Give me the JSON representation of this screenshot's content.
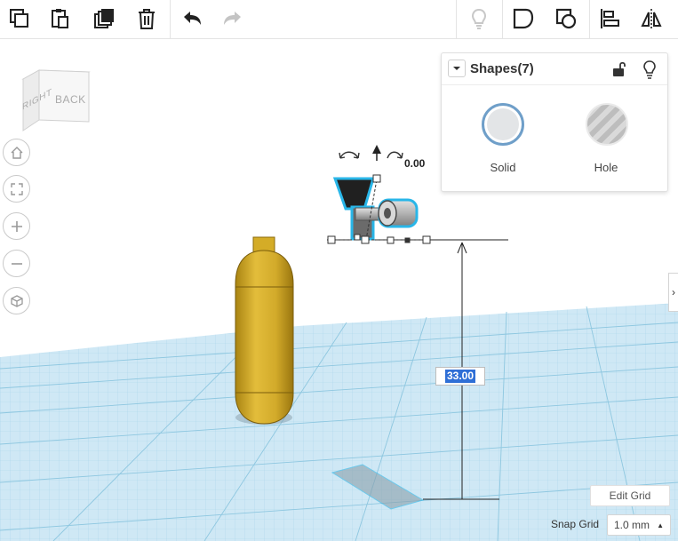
{
  "toolbar": {
    "copy_icon": "copy-icon",
    "paste_icon": "paste-icon",
    "duplicate_icon": "duplicate-icon",
    "delete_icon": "trash-icon",
    "undo_icon": "undo-icon",
    "redo_icon": "redo-icon",
    "notes_icon": "lightbulb-icon",
    "group_icon": "group-icon",
    "ungroup_icon": "ungroup-icon",
    "align_icon": "align-icon",
    "mirror_icon": "mirror-icon"
  },
  "navcube": {
    "right_label": "RIGHT",
    "back_label": "BACK"
  },
  "view_buttons": [
    "home-icon",
    "fit-view-icon",
    "zoom-in-icon",
    "zoom-out-icon",
    "perspective-icon"
  ],
  "inspector": {
    "title": "Shapes(7)",
    "solid_label": "Solid",
    "hole_label": "Hole"
  },
  "workplane": {
    "elevation_value": "33.00",
    "rotation_value": "0.00"
  },
  "grid": {
    "edit_grid_label": "Edit Grid",
    "snap_grid_label": "Snap Grid",
    "snap_grid_value": "1.0 mm"
  },
  "colors": {
    "grid_fill": "#cfe8f5",
    "grid_line": "#9fcfe6",
    "selection": "#29b6e8",
    "shape_yellow": "#d4ac27"
  }
}
